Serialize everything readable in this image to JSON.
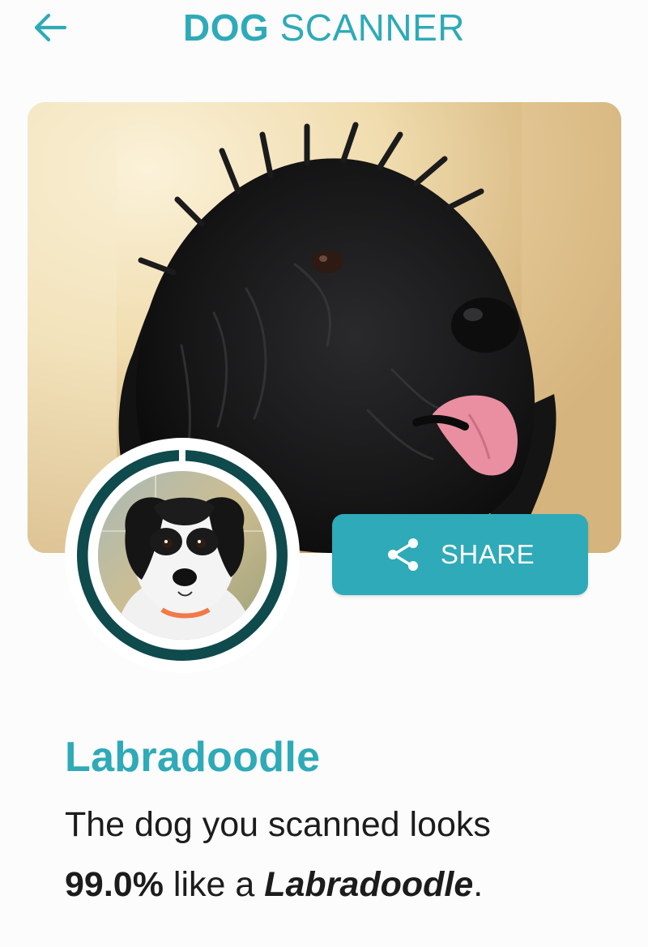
{
  "header": {
    "title_bold": "DOG",
    "title_light": "SCANNER",
    "back_icon": "arrow-left-icon"
  },
  "share": {
    "label": "SHARE",
    "icon": "share-icon"
  },
  "result": {
    "breed": "Labradoodle",
    "line1": "The dog you scanned looks",
    "percent": "99.0%",
    "like_text": " like a ",
    "breed_inline": "Labradoodle",
    "period": "."
  },
  "colors": {
    "accent": "#2eaab8",
    "ring": "#0f4a4d",
    "text": "#1c1c1c",
    "background": "#fcfcfc"
  }
}
